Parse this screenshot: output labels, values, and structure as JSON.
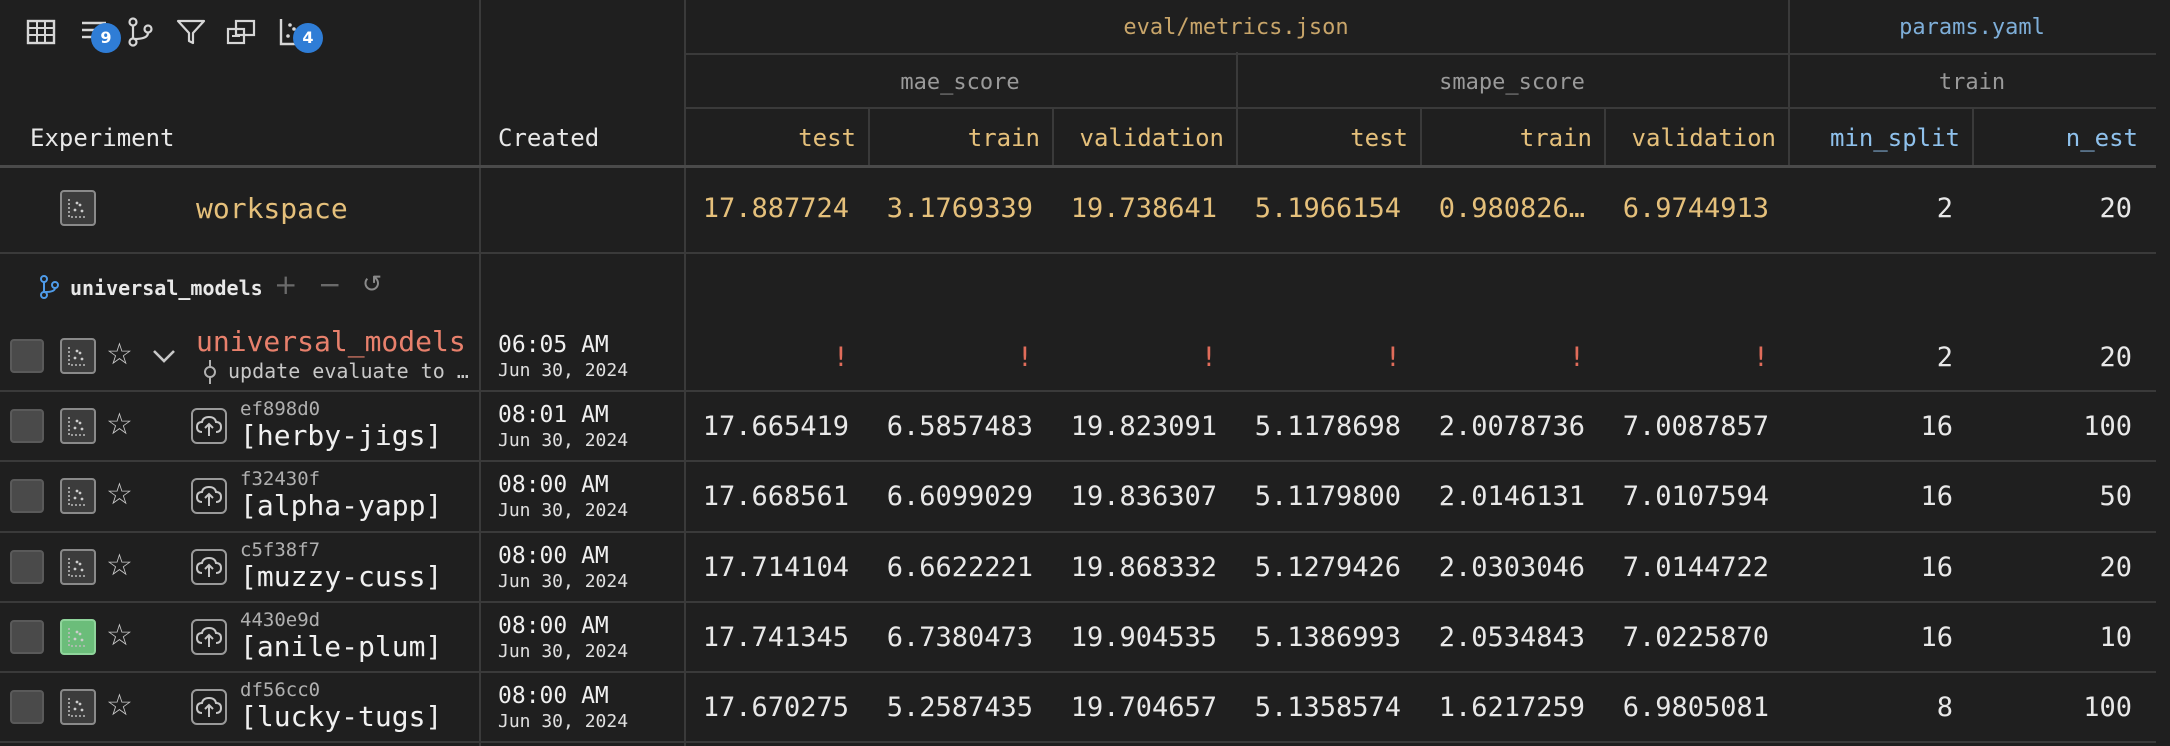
{
  "toolbar": {
    "icons": [
      "table-icon",
      "sort-icon",
      "branch-icon",
      "filter-icon",
      "columns-icon",
      "plots-icon"
    ],
    "sort_count": "9",
    "plots_count": "4"
  },
  "header": {
    "experiment_label": "Experiment",
    "created_label": "Created",
    "metrics_source": "eval/metrics.json",
    "params_source": "params.yaml",
    "groups": {
      "mae": "mae_score",
      "smape": "smape_score",
      "train": "train"
    },
    "columns": [
      "test",
      "train",
      "validation",
      "test",
      "train",
      "validation",
      "min_split",
      "n_est"
    ]
  },
  "workspace": {
    "name": "workspace",
    "values": [
      "17.887724",
      "3.1769339",
      "19.738641",
      "5.1966154",
      "0.980826…",
      "6.9744913",
      "2",
      "20"
    ]
  },
  "branch": {
    "name": "universal_models"
  },
  "parent": {
    "name": "universal_models",
    "commit_message": "update evaluate to …",
    "time": "06:05 AM",
    "date": "Jun 30, 2024",
    "values": [
      "!",
      "!",
      "!",
      "!",
      "!",
      "!",
      "2",
      "20"
    ]
  },
  "experiments": [
    {
      "hash": "ef898d0",
      "name": "[herby-jigs]",
      "time": "08:01 AM",
      "date": "Jun 30, 2024",
      "values": [
        "17.665419",
        "6.5857483",
        "19.823091",
        "5.1178698",
        "2.0078736",
        "7.0087857",
        "16",
        "100"
      ],
      "plotted": false
    },
    {
      "hash": "f32430f",
      "name": "[alpha-yapp]",
      "time": "08:00 AM",
      "date": "Jun 30, 2024",
      "values": [
        "17.668561",
        "6.6099029",
        "19.836307",
        "5.1179800",
        "2.0146131",
        "7.0107594",
        "16",
        "50"
      ],
      "plotted": false
    },
    {
      "hash": "c5f38f7",
      "name": "[muzzy-cuss]",
      "time": "08:00 AM",
      "date": "Jun 30, 2024",
      "values": [
        "17.714104",
        "6.6622221",
        "19.868332",
        "5.1279426",
        "2.0303046",
        "7.0144722",
        "16",
        "20"
      ],
      "plotted": false
    },
    {
      "hash": "4430e9d",
      "name": "[anile-plum]",
      "time": "08:00 AM",
      "date": "Jun 30, 2024",
      "values": [
        "17.741345",
        "6.7380473",
        "19.904535",
        "5.1386993",
        "2.0534843",
        "7.0225870",
        "16",
        "10"
      ],
      "plotted": true
    },
    {
      "hash": "df56cc0",
      "name": "[lucky-tugs]",
      "time": "08:00 AM",
      "date": "Jun 30, 2024",
      "values": [
        "17.670275",
        "5.2587435",
        "19.704657",
        "5.1358574",
        "1.6217259",
        "6.9805081",
        "8",
        "100"
      ],
      "plotted": false
    }
  ],
  "colors": {
    "background": "#1f1f1f",
    "metric_header": "#e5c07b",
    "param_header": "#8fc1ec",
    "workspace_text": "#e5c07b",
    "error_text": "#e06c5a",
    "badge": "#2f7dd6",
    "plotted": "#6bbd7a"
  }
}
